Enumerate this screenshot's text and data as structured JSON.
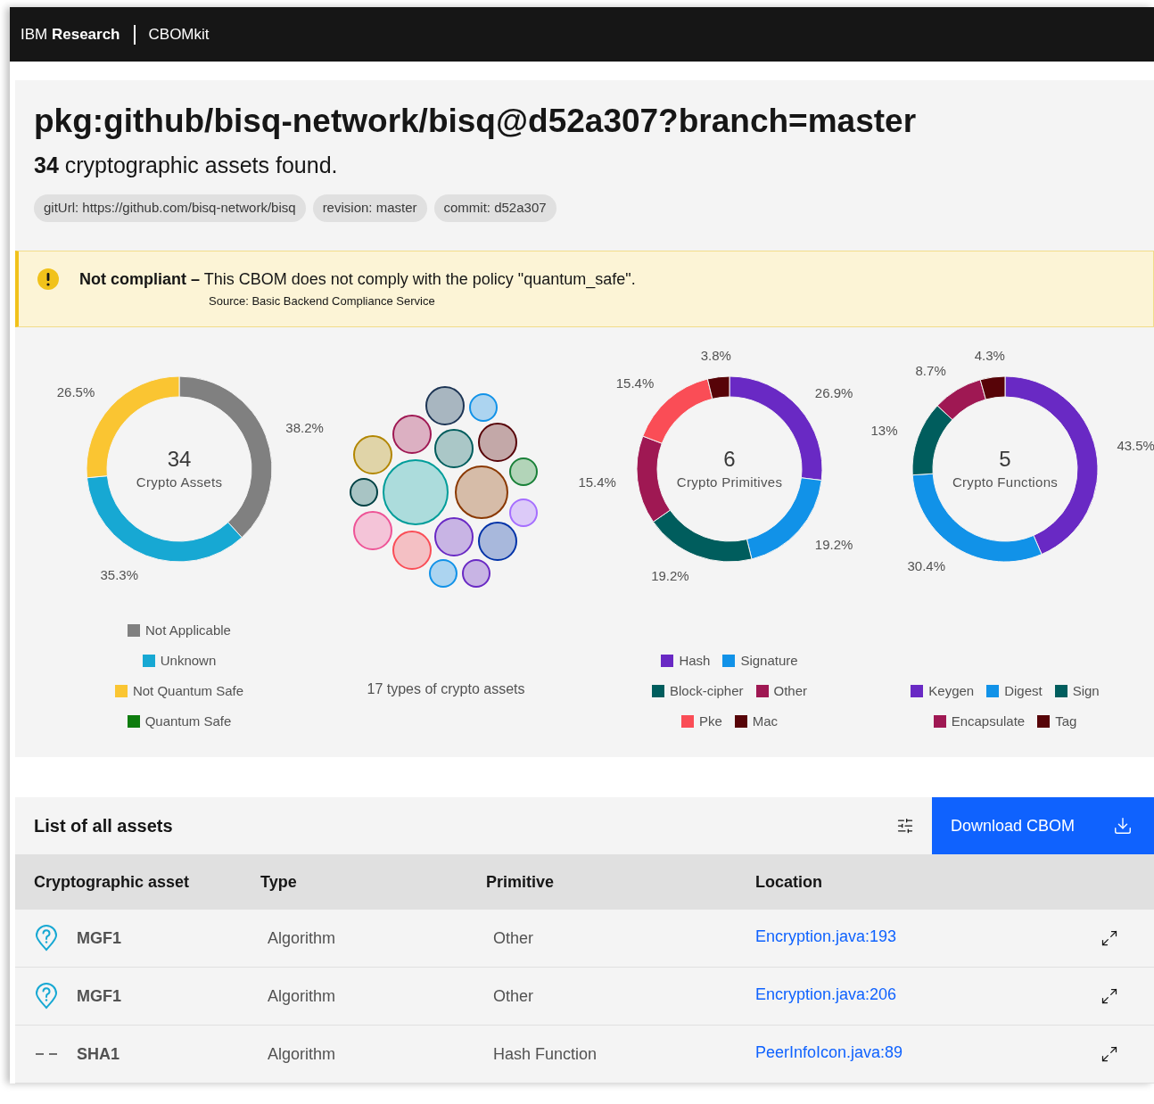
{
  "header": {
    "brand": "IBM **Research**",
    "product": "CBOMkit"
  },
  "title": "pkg:github/bisq-network/bisq@d52a307?branch=master",
  "summary": "**34** cryptographic assets found.",
  "tags": [
    "gitUrl: https://github.com/bisq-network/bisq",
    "revision: master",
    "commit: d52a307"
  ],
  "banner": {
    "message": "**Not compliant –** This CBOM does not comply with the policy \"quantum_safe\".",
    "source": "Source: Basic Backend Compliance Service"
  },
  "charts": [
    {
      "center_value": "34",
      "center_label": "Crypto Assets",
      "chart_data": {
        "type": "donut",
        "categories": [
          "Not Applicable",
          "Unknown",
          "Not Quantum Safe",
          "Quantum Safe"
        ],
        "series": [
          {
            "values": [
              38.2,
              35.3,
              26.5,
              0
            ]
          }
        ],
        "colors": [
          "#808080",
          "#17a8d3",
          "#fac532",
          "#0e7c0e"
        ],
        "value_labels": [
          "38.2%",
          "35.3%",
          "26.5%",
          null
        ]
      }
    },
    {
      "center_value": "6",
      "center_label": "Crypto Primitives",
      "chart_data": {
        "type": "donut",
        "categories": [
          "Hash",
          "Signature",
          "Block-cipher",
          "Other",
          "Pke",
          "Mac"
        ],
        "series": [
          {
            "values": [
              26.9,
              19.2,
              19.2,
              15.4,
              15.4,
              3.8
            ]
          }
        ],
        "colors": [
          "#6929c4",
          "#1192e8",
          "#005d5d",
          "#9f1853",
          "#fa4d56",
          "#570408"
        ],
        "value_labels": [
          "26.9%",
          "19.2%",
          "19.2%",
          "15.4%",
          "15.4%",
          "3.8%"
        ]
      }
    },
    {
      "center_value": "5",
      "center_label": "Crypto Functions",
      "chart_data": {
        "type": "donut",
        "categories": [
          "Keygen",
          "Digest",
          "Sign",
          "Encapsulate",
          "Tag"
        ],
        "series": [
          {
            "values": [
              43.5,
              30.4,
              13,
              8.7,
              4.3
            ]
          }
        ],
        "colors": [
          "#6929c4",
          "#1192e8",
          "#005d5d",
          "#9f1853",
          "#570408"
        ],
        "value_labels": [
          "43.5%",
          "30.4%",
          "13%",
          "8.7%",
          "4.3%"
        ]
      }
    }
  ],
  "bubbles": {
    "kind": "picture",
    "caption": "17 types of crypto assets"
  },
  "table": {
    "title": "List of all assets",
    "download_label": "Download CBOM",
    "columns": [
      "Cryptographic asset",
      "Type",
      "Primitive",
      "Location"
    ],
    "rows": [
      {
        "kind": "unknown",
        "asset": "MGF1",
        "type": "Algorithm",
        "primitive": "Other",
        "location": "Encryption.java:193"
      },
      {
        "kind": "unknown",
        "asset": "MGF1",
        "type": "Algorithm",
        "primitive": "Other",
        "location": "Encryption.java:206"
      },
      {
        "kind": "not-applicable",
        "asset": "SHA1",
        "type": "Algorithm",
        "primitive": "Hash Function",
        "location": "PeerInfoIcon.java:89"
      }
    ]
  }
}
